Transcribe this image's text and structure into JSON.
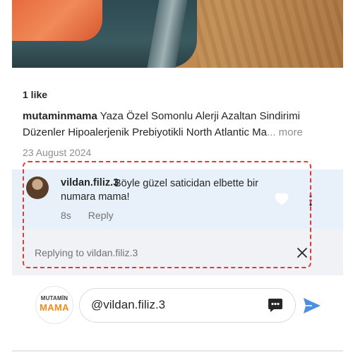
{
  "post": {
    "likes_text": "1 like",
    "caption_user": "mutaminmama",
    "caption_text": "Yaza Özel Somonlu Alerji Azaltan Sindirimi Düzenler Hipoalerjenik Prebiyotikli North Atlantic Ma",
    "caption_more": "... more",
    "date": "23 August 2024"
  },
  "comment": {
    "username": "vildan.filiz.3",
    "text": "Böyle güzel saticidan elbette bir numara mama!",
    "time": "8s",
    "reply_label": "Reply"
  },
  "replying_banner": {
    "text": "Replying to vildan.filiz.3"
  },
  "composer": {
    "brand_top": "MUTAMİN",
    "brand_bottom": "MAMA",
    "input_value": "@vildan.filiz.3"
  },
  "colors": {
    "highlight": "#e53935",
    "comment_band": "#e8f0f9",
    "send": "#4a90e2",
    "brand_orange": "#f08a1c"
  },
  "icons": {
    "heart": "heart-icon",
    "more": "more-options-icon",
    "close": "close-icon",
    "gif": "gif-sticker-icon",
    "send": "send-icon"
  }
}
